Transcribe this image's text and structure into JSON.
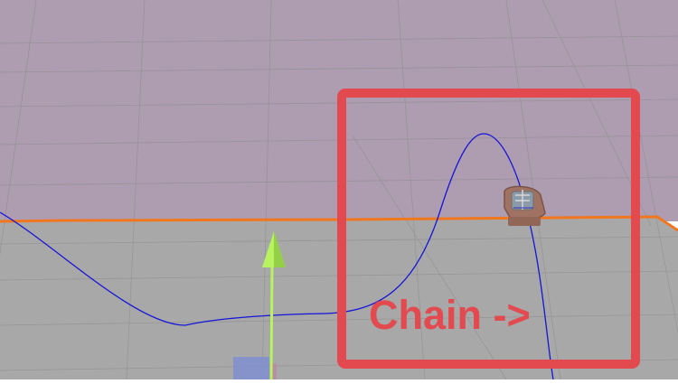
{
  "viewport": {
    "upper_region_color": "#ae9cb1",
    "lower_region_color": "#a8a8a8",
    "grid_line_color": "#8f8f8f",
    "boundary_line_color": "#f1771f",
    "spline_color": "#1515d8",
    "gizmo_arrow_color": "#b7f25f",
    "gizmo_handle_color": "#7f8fd0"
  },
  "selected_object": {
    "icon": "cart-icon",
    "color": "#a07264"
  },
  "annotation": {
    "label": "Chain ->",
    "color": "#e24a4f"
  }
}
